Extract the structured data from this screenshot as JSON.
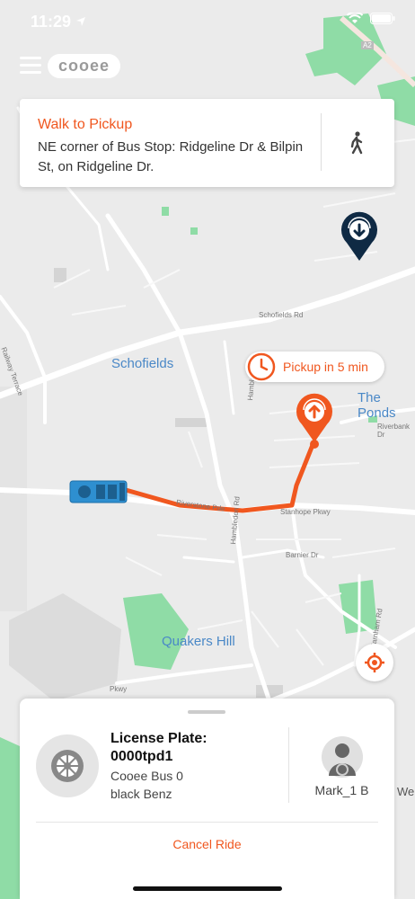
{
  "status_bar": {
    "time": "11:29"
  },
  "app": {
    "logo": "cooee"
  },
  "walk_card": {
    "title": "Walk to Pickup",
    "description": "NE corner of Bus Stop: Ridgeline Dr & Bilpin St, on Ridgeline Dr."
  },
  "map": {
    "labels": {
      "schofields": "Schofields",
      "the_ponds": "The Ponds",
      "quakers_hill": "Quakers Hill"
    },
    "streets": {
      "schofields_rd": "Schofields Rd",
      "railway_tce": "Railway Terrace",
      "riverstone_pde": "Riverstone Pde",
      "hambledon_rd": "Hambledon Rd",
      "stanhope_pkwy": "Stanhope Pkwy",
      "riverbank_dr": "Riverbank Dr",
      "barnier_dr": "Barnier Dr",
      "farnham_rd": "Farnham Rd",
      "pkwy": "Pkwy",
      "hamble": "Hamble",
      "a2": "A2",
      "we": "We"
    },
    "pickup_bubble": "Pickup in 5 min",
    "accent": "#f0571f",
    "route_color": "#f0571f"
  },
  "ride_panel": {
    "plate_label": "License Plate:",
    "plate_number": "0000tpd1",
    "vehicle_name": "Cooee Bus 0",
    "vehicle_model": "black Benz",
    "driver_name": "Mark_1 B",
    "cancel_label": "Cancel Ride"
  }
}
